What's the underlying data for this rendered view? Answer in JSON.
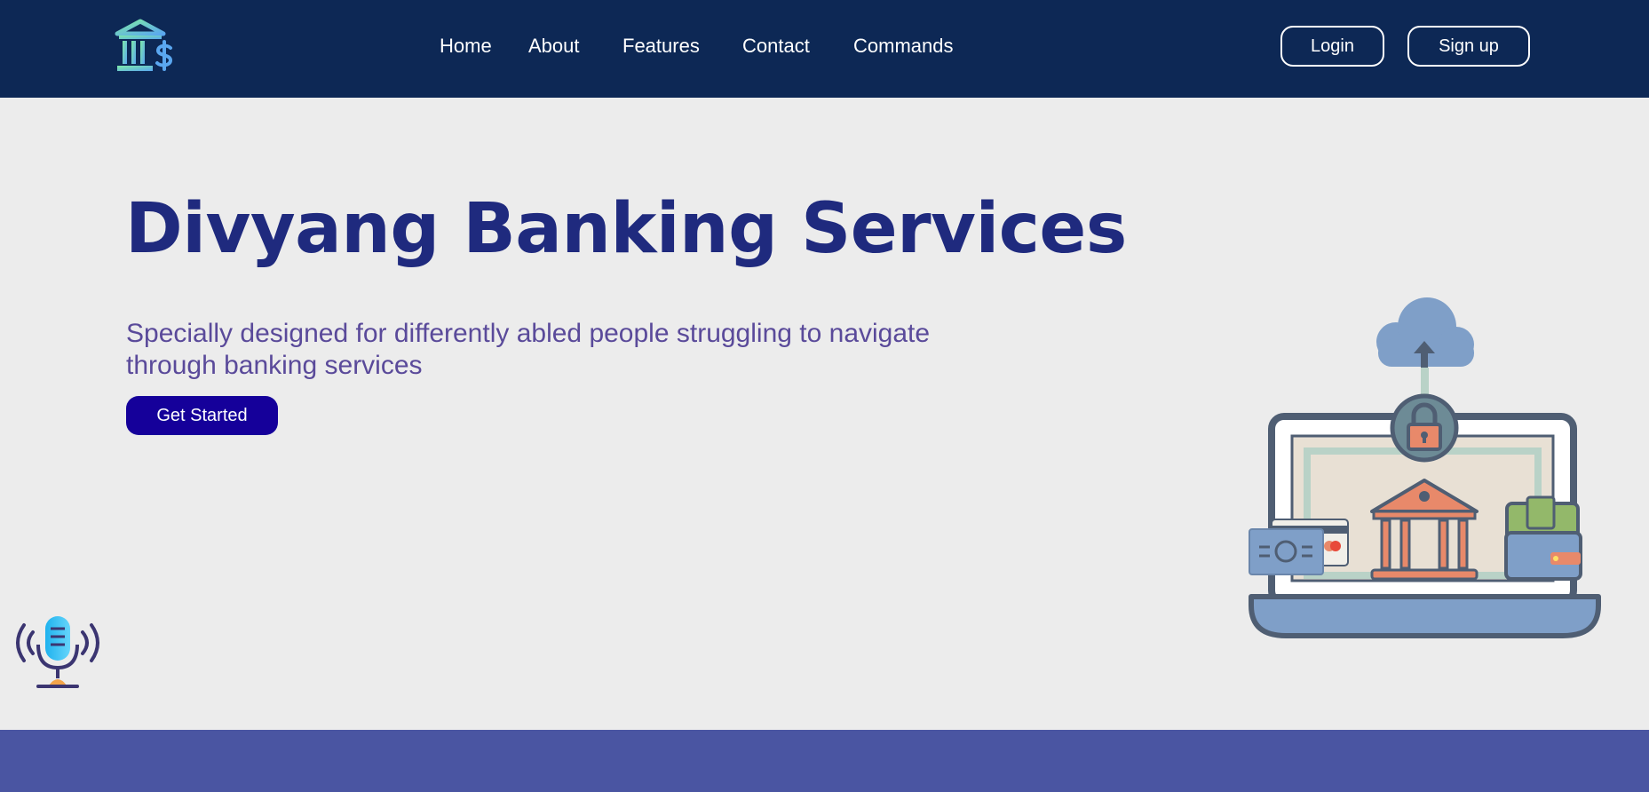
{
  "app": {
    "title": "Divyang Banking Services"
  },
  "navbar": {
    "logo_icon": "bank-dollar-icon",
    "links": [
      {
        "label": "Home"
      },
      {
        "label": "About"
      },
      {
        "label": "Features"
      },
      {
        "label": "Contact"
      },
      {
        "label": "Commands"
      }
    ],
    "login_label": "Login",
    "signup_label": "Sign up"
  },
  "hero": {
    "title": "Divyang Banking Services",
    "subtitle": "Specially designed for differently abled people struggling to navigate through banking services",
    "cta_label": "Get Started",
    "illustration_icon": "online-banking-laptop-icon"
  },
  "voice": {
    "icon": "microphone-icon"
  },
  "colors": {
    "navbar_bg": "#0d2855",
    "page_bg": "#ececec",
    "title": "#1f2a7e",
    "subtitle": "#5a4a9a",
    "cta_bg": "#15009a",
    "footer_band": "#4a55a2"
  }
}
